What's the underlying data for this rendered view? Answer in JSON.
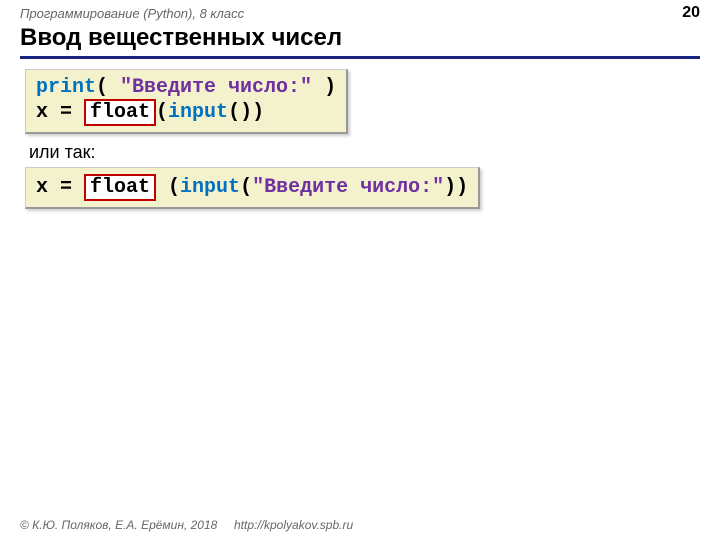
{
  "header": {
    "course": "Программирование (Python), 8 класс",
    "page": "20"
  },
  "title": "Ввод вещественных чисел",
  "code1": {
    "print": "print",
    "open1": "( ",
    "str": "\"Введите число:\"",
    "close1": " )",
    "line2_pre": "x = ",
    "float": "float",
    "open2": "(",
    "input": "input",
    "parens": "())"
  },
  "or_text": "или так:",
  "code2": {
    "pre": "x = ",
    "float": "float",
    "space": " (",
    "input": "input",
    "open": "(",
    "str": "\"Введите число:\"",
    "close": "))"
  },
  "footer": {
    "copyright": "© К.Ю. Поляков, Е.А. Ерёмин, 2018",
    "url": "http://kpolyakov.spb.ru"
  }
}
